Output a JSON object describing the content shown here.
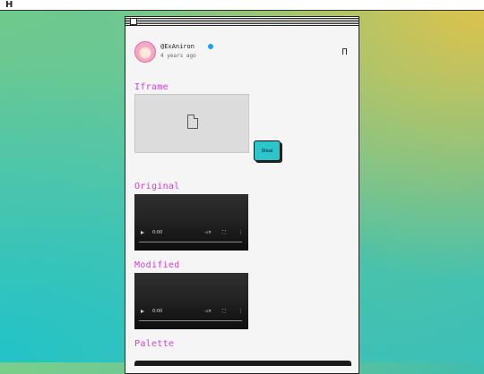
{
  "app": {
    "logo_text": "H"
  },
  "post": {
    "username": "@ExAniron",
    "time_ago": "4 years ago"
  },
  "sections": {
    "iframe_label": "Iframe",
    "original_label": "Original",
    "modified_label": "Modified",
    "palette_label": "Palette"
  },
  "buttons": {
    "steal_label": "Steal"
  },
  "videos": {
    "original": {
      "time": "0:00"
    },
    "modified": {
      "time": "0:00"
    }
  },
  "icons": {
    "verified": "verified-badge-icon",
    "bookmark": "bookmark-icon",
    "broken_doc": "broken-document-icon",
    "play": "play-icon",
    "mute": "volume-muted-icon",
    "fullscreen": "fullscreen-icon",
    "more": "more-vertical-icon"
  },
  "colors": {
    "accent_label": "#d040d0",
    "steal_button": "#2cc5cc",
    "verified": "#1da1f2"
  }
}
